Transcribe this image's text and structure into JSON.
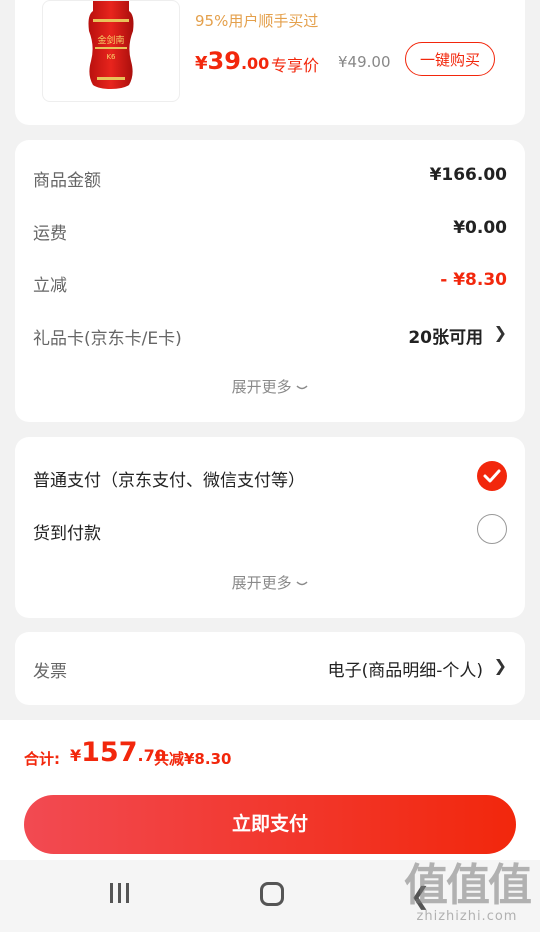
{
  "product": {
    "promo_text": "95%用户顺手买过",
    "price_symbol": "¥",
    "price_int": "39",
    "price_dec": ".00",
    "price_tag": "专享价",
    "original_price": "¥49.00",
    "buy_button": "一键购买",
    "bottle_logo": "金剑南",
    "bottle_sub": "K6"
  },
  "summary": {
    "rows": [
      {
        "label": "商品金额",
        "value": "¥166.00"
      },
      {
        "label": "运费",
        "value": "¥0.00"
      },
      {
        "label": "立减",
        "value": "- ¥8.30"
      },
      {
        "label": "礼品卡(京东卡/E卡)",
        "value": "20张可用"
      }
    ],
    "expand": "展开更多"
  },
  "payment": {
    "options": [
      {
        "label": "普通支付（京东支付、微信支付等）",
        "selected": true
      },
      {
        "label": "货到付款",
        "selected": false
      }
    ],
    "expand": "展开更多"
  },
  "invoice": {
    "label": "发票",
    "value": "电子(商品明细-个人)"
  },
  "total": {
    "label": "合计:",
    "symbol": "¥",
    "int": "157",
    "dec": ".70",
    "discount": "共减¥8.30"
  },
  "pay_button": "立即支付",
  "watermark": {
    "mark": "值值值",
    "site": "zhizhizhi.com"
  },
  "colors": {
    "accent": "#f2270c",
    "promo": "#e4a04c",
    "background": "#f2f2f2"
  },
  "icons": [
    "chevron-right-icon",
    "check-circle-icon",
    "chevron-down-icon",
    "nav-recent-icon",
    "nav-home-icon",
    "nav-back-icon"
  ]
}
